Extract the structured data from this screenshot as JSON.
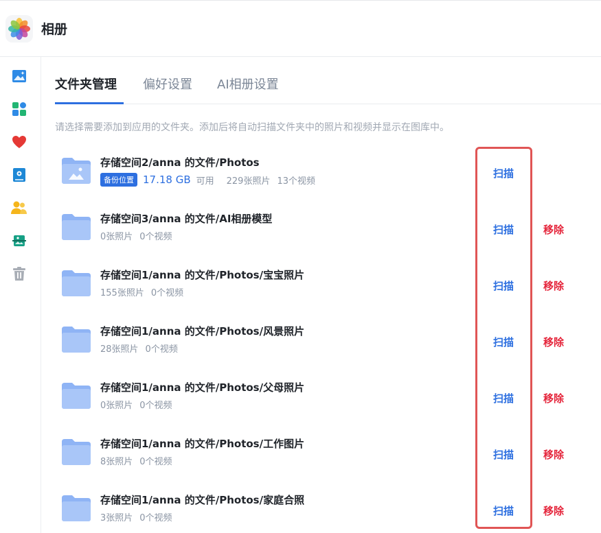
{
  "app": {
    "title": "相册"
  },
  "sidebar": {
    "items": [
      {
        "icon": "photo-icon",
        "color": "#2f8be6"
      },
      {
        "icon": "albums-icon",
        "color": "#22b573"
      },
      {
        "icon": "heart-icon",
        "color": "#e53935"
      },
      {
        "icon": "album-book-icon",
        "color": "#1e88d6"
      },
      {
        "icon": "people-icon",
        "color": "#f5b51b"
      },
      {
        "icon": "scan-frame-icon",
        "color": "#16a085"
      },
      {
        "icon": "trash-icon",
        "color": "#a8adb5"
      }
    ]
  },
  "tabs": [
    {
      "label": "文件夹管理",
      "active": true
    },
    {
      "label": "偏好设置",
      "active": false
    },
    {
      "label": "AI相册设置",
      "active": false
    }
  ],
  "hint": "请选择需要添加到应用的文件夹。添加后将自动扫描文件夹中的照片和视频并显示在图库中。",
  "actions": {
    "scan_label": "扫描",
    "remove_label": "移除"
  },
  "folders": [
    {
      "name": "存储空间2/anna 的文件/Photos",
      "backup": true,
      "badge": "备份位置",
      "space": "17.18 GB",
      "space_suffix": "可用",
      "photos": "229张照片",
      "videos": "13个视频",
      "removable": false
    },
    {
      "name": "存储空间3/anna 的文件/AI相册模型",
      "photos": "0张照片",
      "videos": "0个视频",
      "removable": true
    },
    {
      "name": "存储空间1/anna 的文件/Photos/宝宝照片",
      "photos": "155张照片",
      "videos": "0个视频",
      "removable": true
    },
    {
      "name": "存储空间1/anna 的文件/Photos/风景照片",
      "photos": "28张照片",
      "videos": "0个视频",
      "removable": true
    },
    {
      "name": "存储空间1/anna 的文件/Photos/父母照片",
      "photos": "0张照片",
      "videos": "0个视频",
      "removable": true
    },
    {
      "name": "存储空间1/anna 的文件/Photos/工作图片",
      "photos": "8张照片",
      "videos": "0个视频",
      "removable": true
    },
    {
      "name": "存储空间1/anna 的文件/Photos/家庭合照",
      "photos": "3张照片",
      "videos": "0个视频",
      "removable": true
    }
  ],
  "colors": {
    "accent": "#2d6fe0",
    "danger": "#e5263c",
    "highlight": "#e05555"
  }
}
